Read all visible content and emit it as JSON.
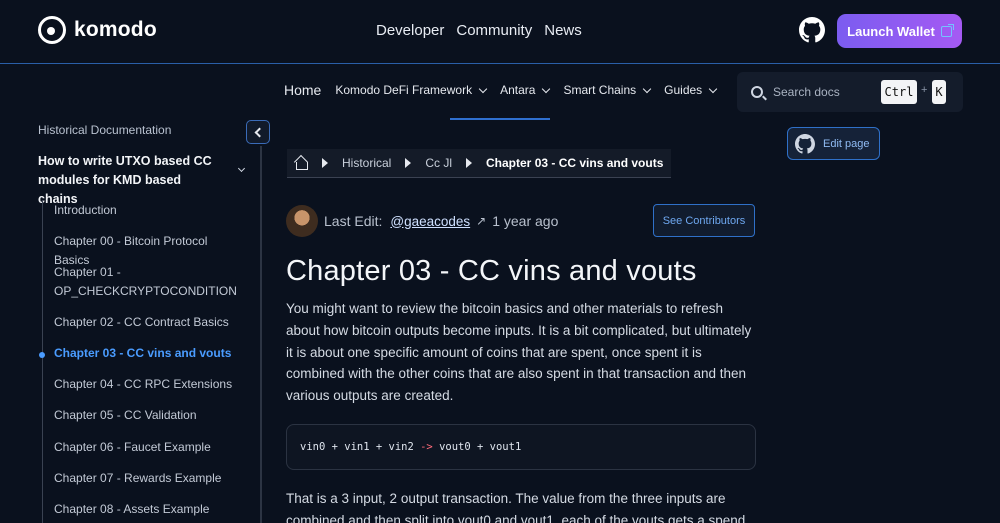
{
  "brand": {
    "name": "komodo"
  },
  "topnav": {
    "items": [
      "Developer",
      "Community",
      "News"
    ]
  },
  "launch_wallet": {
    "label": "Launch Wallet"
  },
  "subnav": {
    "items": [
      {
        "label": "Home",
        "has_chevron": false
      },
      {
        "label": "Komodo DeFi Framework",
        "has_chevron": true
      },
      {
        "label": "Antara",
        "has_chevron": true
      },
      {
        "label": "Smart Chains",
        "has_chevron": true
      },
      {
        "label": "Guides",
        "has_chevron": true
      }
    ]
  },
  "search": {
    "placeholder": "Search docs",
    "shortcut_ctrl": "Ctrl",
    "shortcut_plus": "+",
    "shortcut_key": "K"
  },
  "sidebar": {
    "title": "Historical Documentation",
    "section": "How to write UTXO based CC modules for KMD based chains",
    "items": [
      "Introduction",
      "Chapter 00 - Bitcoin Protocol Basics",
      "Chapter 01 - OP_CHECKCRYPTOCONDITION",
      "Chapter 02 - CC Contract Basics",
      "Chapter 03 - CC vins and vouts",
      "Chapter 04 - CC RPC Extensions",
      "Chapter 05 - CC Validation",
      "Chapter 06 - Faucet Example",
      "Chapter 07 - Rewards Example",
      "Chapter 08 - Assets Example"
    ],
    "active_index": 4
  },
  "breadcrumb": {
    "items": [
      "Historical",
      "Cc Jl",
      "Chapter 03 - CC vins and vouts"
    ]
  },
  "meta": {
    "last_edit_label": "Last Edit:",
    "user": "@gaeacodes",
    "arrow": "↗",
    "ago": "1 year ago"
  },
  "contributors": {
    "label": "See Contributors"
  },
  "edit_page": {
    "label": "Edit page"
  },
  "article": {
    "title": "Chapter 03 - CC vins and vouts",
    "p1": "You might want to review the bitcoin basics and other materials to refresh about how bitcoin outputs become inputs. It is a bit complicated, but ultimately it is about one specific amount of coins that are spent, once spent it is combined with the other coins that are also spent in that transaction and then various outputs are created.",
    "code_parts": [
      "vin0 + vin1 + vin2 ",
      "->",
      " vout0 + vout1"
    ],
    "p2": "That is a 3 input, 2 output transaction. The value from the three inputs are combined and then split into vout0 and vout1, each of the vouts gets a spend"
  }
}
